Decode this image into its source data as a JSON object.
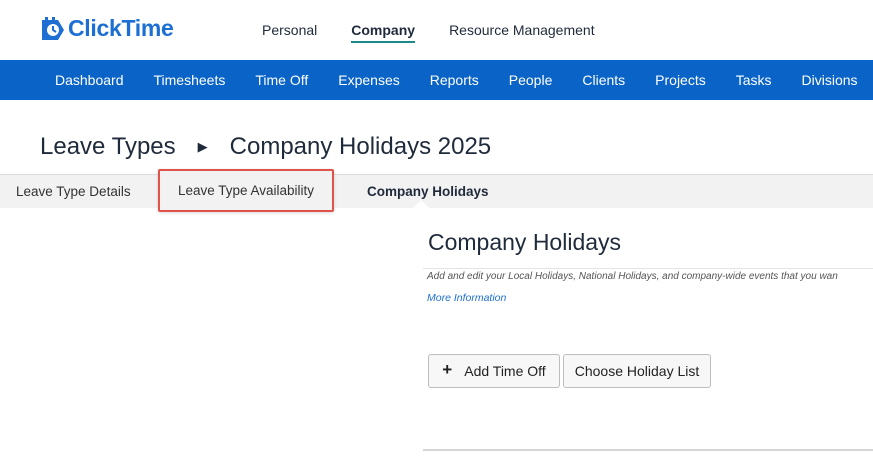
{
  "header": {
    "logo_text": "ClickTime",
    "top_nav": [
      {
        "label": "Personal",
        "active": false
      },
      {
        "label": "Company",
        "active": true
      },
      {
        "label": "Resource Management",
        "active": false
      }
    ]
  },
  "main_nav": {
    "items": [
      "Dashboard",
      "Timesheets",
      "Time Off",
      "Expenses",
      "Reports",
      "People",
      "Clients",
      "Projects",
      "Tasks",
      "Divisions"
    ]
  },
  "breadcrumb": {
    "parent": "Leave Types",
    "current": "Company Holidays 2025",
    "separator_icon": "triangle-right-icon"
  },
  "sub_tabs": {
    "details": "Leave Type Details",
    "availability": "Leave Type Availability",
    "holidays": "Company Holidays",
    "active": "Company Holidays"
  },
  "content": {
    "title": "Company Holidays",
    "description": "Add and edit your Local Holidays, National Holidays, and company-wide events that you wan",
    "more_info": "More Information",
    "add_button": "Add Time Off",
    "add_icon": "plus-icon",
    "choose_button": "Choose Holiday List"
  },
  "colors": {
    "brand_blue": "#0a64c8",
    "logo_blue": "#1d6fd3",
    "highlight_red": "#e0534a",
    "active_underline": "#1d8a8a"
  }
}
